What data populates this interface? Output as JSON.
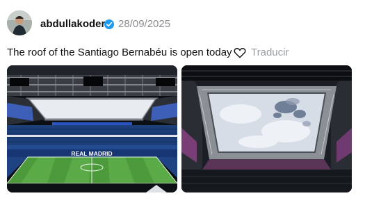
{
  "post": {
    "username": "abdullakoder",
    "date": "28/09/2025",
    "text": "The roof of the Santiago Bernabéu is open today",
    "translate_label": "Traducir",
    "verified_icon": "verified-badge-icon",
    "like_icon": "heart-outline-icon"
  },
  "images": {
    "photo1": {
      "banner_text": "REAL MADRID"
    }
  },
  "colors": {
    "verified": "#1d9bf0",
    "secondary_text": "#8a8d91",
    "pitch": "#4c9a3c",
    "stands": "#1c3f7a"
  }
}
